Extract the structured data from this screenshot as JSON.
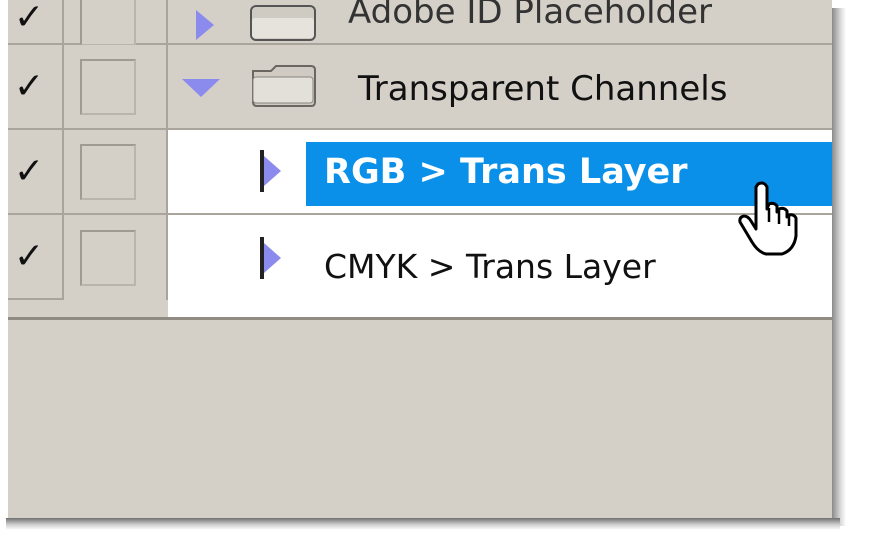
{
  "layers_panel": {
    "rows": [
      {
        "type": "layer-set",
        "label": "Adobe ID Placeholder",
        "visible": true,
        "expanded": false
      },
      {
        "type": "layer-set",
        "label": "Transparent Channels",
        "visible": true,
        "expanded": true
      },
      {
        "type": "layer",
        "label": "RGB > Trans Layer",
        "visible": true,
        "selected": true
      },
      {
        "type": "layer",
        "label": "CMYK > Trans Layer",
        "visible": true,
        "selected": false
      }
    ]
  },
  "colors": {
    "panel_bg": "#d4d0c8",
    "selection": "#0a90e8",
    "triangle": "#8b8bee"
  },
  "icons": {
    "visibility": "checkmark-icon",
    "link": "link-box-icon",
    "expand": "disclosure-triangle-icon",
    "folder": "folder-icon",
    "cursor": "hand-pointer-icon"
  }
}
